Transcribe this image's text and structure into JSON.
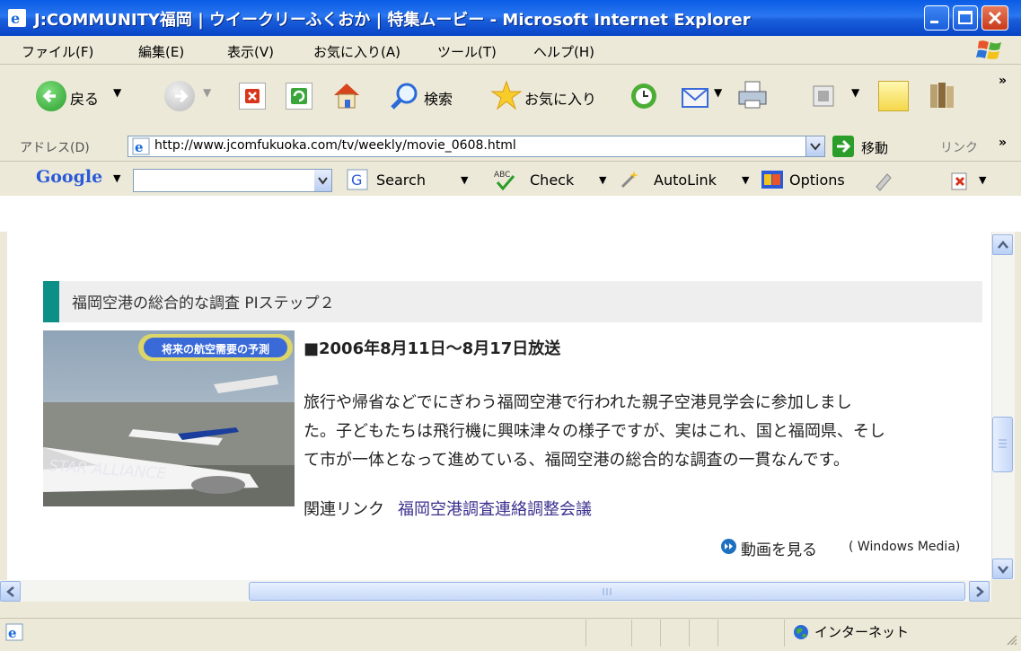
{
  "window": {
    "title": "J:COMMUNITY福岡 | ウイークリーふくおか | 特集ムービー - Microsoft Internet Explorer"
  },
  "menu": [
    "ファイル(F)",
    "編集(E)",
    "表示(V)",
    "お気に入り(A)",
    "ツール(T)",
    "ヘルプ(H)"
  ],
  "toolbar": {
    "back_label": "戻る",
    "search_label": "検索",
    "favorites_label": "お気に入り",
    "overflow": "»"
  },
  "address": {
    "label": "アドレス(D)",
    "url": "http://www.jcomfukuoka.com/tv/weekly/movie_0608.html",
    "go_label": "移動",
    "links_label": "リンク",
    "overflow": "»"
  },
  "googlebar": {
    "logo": "Google",
    "search_label": "Search",
    "check_label": "Check",
    "autolink_label": "AutoLink",
    "options_label": "Options",
    "search_value": ""
  },
  "content": {
    "section_title": "福岡空港の総合的な調査 PIステップ２",
    "thumbnail_caption": "将来の航空需要の予測",
    "thumbnail_text": "STAR ALLIANCE",
    "broadcast_date": "■2006年8月11日〜8月17日放送",
    "description": [
      "旅行や帰省などでにぎわう福岡空港で行われた親子空港見学会に参加しまし",
      "た。子どもたちは飛行機に興味津々の様子ですが、実はこれ、国と福岡県、そし",
      "て市が一体となって進めている、福岡空港の総合的な調査の一貫なんです。"
    ],
    "related_label": "関連リンク",
    "related_link": "福岡空港調査連絡調整会議",
    "movie_link": "動画を見る",
    "movie_note": "( Windows Media)"
  },
  "status": {
    "zone": "インターネット"
  },
  "colors": {
    "titlebar": "#0a5ce6",
    "accent_teal": "#0c8f86",
    "link": "#3a2f8c"
  }
}
